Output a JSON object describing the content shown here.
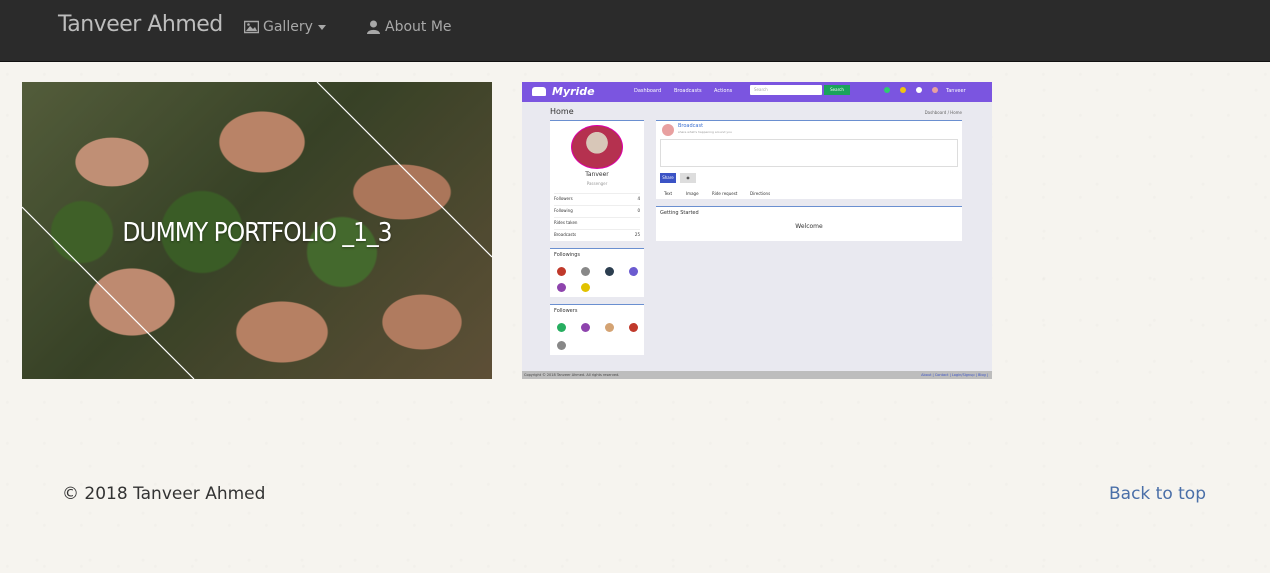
{
  "navbar": {
    "brand": "Tanveer Ahmed",
    "items": [
      {
        "label": "Gallery",
        "icon": "image-icon",
        "has_caret": true
      },
      {
        "label": "About Me",
        "icon": "user-icon"
      }
    ]
  },
  "gallery": {
    "tiles": [
      {
        "title": "DUMMY PORTFOLIO _1_3",
        "image": "hands-holding-seedlings"
      },
      {
        "image": "myride-app-screenshot",
        "app": {
          "logo": "Myride",
          "nav_links": [
            "Dashboard",
            "Broadcasts",
            "Actions"
          ],
          "search_placeholder": "Search",
          "search_button": "Search",
          "user": "Tanveer",
          "page_title": "Home",
          "breadcrumb": "Dashboard / Home",
          "profile_name": "Tanveer",
          "profile_role": "Passenger",
          "stats": [
            {
              "label": "Followers",
              "value": "4"
            },
            {
              "label": "Following",
              "value": "0"
            },
            {
              "label": "Rides taken",
              "value": ""
            },
            {
              "label": "Broadcasts",
              "value": "25"
            }
          ],
          "followings_title": "Followings",
          "followers_title": "Followers",
          "broadcast_title": "Broadcast",
          "broadcast_sub": "share what's happening around you",
          "share_button": "Share",
          "tabs": [
            "Text",
            "Image",
            "Ride request",
            "Directions"
          ],
          "getting_started": "Getting Started",
          "welcome": "Welcome",
          "footer_left": "Copyright © 2018 Tanveer Ahmed. All rights reserved.",
          "footer_right": "About | Contact | Login/Signup | Blog |"
        }
      }
    ]
  },
  "footer": {
    "copyright": "© 2018 Tanveer Ahmed",
    "back_to_top": "Back to top"
  },
  "colors": {
    "navbar_bg": "#2b2b2b",
    "page_bg": "#f6f4ef",
    "link": "#4a6fa8",
    "app_accent": "#7b55e0"
  }
}
